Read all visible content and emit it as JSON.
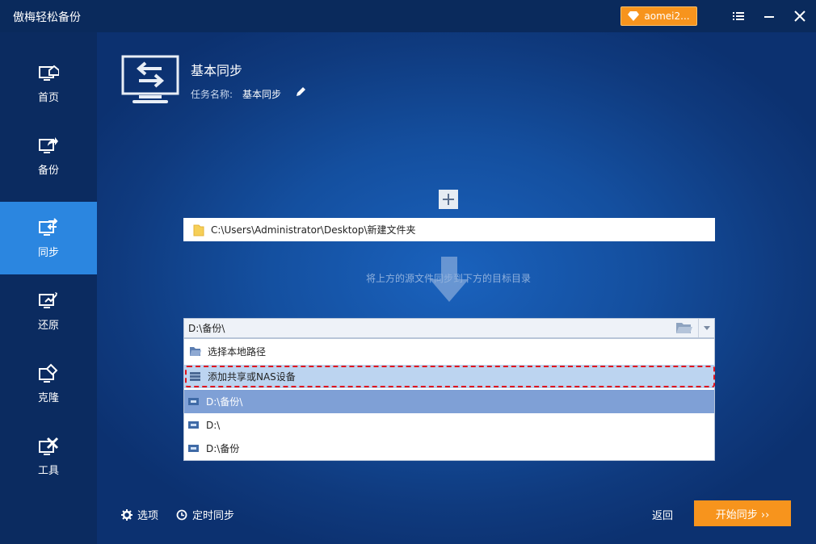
{
  "app": {
    "title": "傲梅轻松备份",
    "account_label": "aomei2...",
    "colors": {
      "accent": "#2b86e0",
      "orange": "#f7941d",
      "titlebar": "#0a2a5c",
      "highlight_outline": "#e0141d"
    }
  },
  "sidebar": {
    "items": [
      {
        "label": "首页",
        "icon": "home-monitor-icon",
        "active": false
      },
      {
        "label": "备份",
        "icon": "backup-monitor-icon",
        "active": false
      },
      {
        "label": "同步",
        "icon": "sync-monitor-icon",
        "active": true
      },
      {
        "label": "还原",
        "icon": "restore-monitor-icon",
        "active": false
      },
      {
        "label": "克隆",
        "icon": "clone-monitor-icon",
        "active": false
      },
      {
        "label": "工具",
        "icon": "tools-monitor-icon",
        "active": false
      }
    ]
  },
  "task": {
    "title": "基本同步",
    "name_label": "任务名称:",
    "name_value": "基本同步"
  },
  "source": {
    "path": "C:\\Users\\Administrator\\Desktop\\新建文件夹"
  },
  "hint": "将上方的源文件同步到下方的目标目录",
  "destination": {
    "value": "D:\\备份\\",
    "options": [
      {
        "label": "选择本地路径",
        "icon": "folder-open-icon"
      },
      {
        "label": "添加共享或NAS设备",
        "icon": "nas-device-icon"
      },
      {
        "label": "D:\\备份\\",
        "icon": "drive-icon"
      },
      {
        "label": "D:\\",
        "icon": "drive-icon"
      },
      {
        "label": "D:\\备份",
        "icon": "drive-icon"
      }
    ]
  },
  "footer": {
    "options_label": "选项",
    "schedule_label": "定时同步",
    "back_label": "返回",
    "start_label": "开始同步 ››"
  }
}
